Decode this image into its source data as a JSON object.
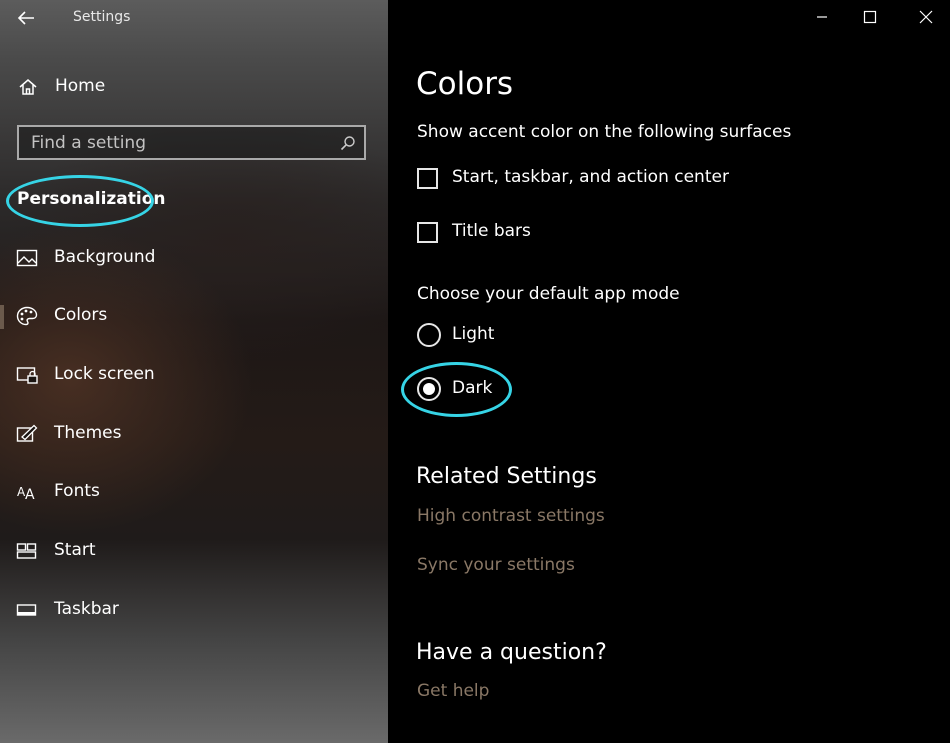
{
  "window": {
    "title": "Settings",
    "back_icon": "back-arrow-icon",
    "caption_buttons": [
      "minimize-icon",
      "maximize-icon",
      "close-icon"
    ]
  },
  "sidebar": {
    "home_label": "Home",
    "search": {
      "placeholder": "Find a setting"
    },
    "section_heading": "Personalization",
    "items": [
      {
        "label": "Background",
        "icon": "picture-icon"
      },
      {
        "label": "Colors",
        "icon": "palette-icon",
        "selected": true
      },
      {
        "label": "Lock screen",
        "icon": "lock-screen-icon"
      },
      {
        "label": "Themes",
        "icon": "themes-icon"
      },
      {
        "label": "Fonts",
        "icon": "fonts-icon"
      },
      {
        "label": "Start",
        "icon": "start-icon"
      },
      {
        "label": "Taskbar",
        "icon": "taskbar-icon"
      }
    ]
  },
  "main": {
    "title": "Colors",
    "accent_label": "Show accent color on the following surfaces",
    "checkboxes": [
      {
        "label": "Start, taskbar, and action center",
        "checked": false
      },
      {
        "label": "Title bars",
        "checked": false
      }
    ],
    "app_mode_label": "Choose your default app mode",
    "radios": [
      {
        "label": "Light",
        "selected": false
      },
      {
        "label": "Dark",
        "selected": true
      }
    ],
    "related_title": "Related Settings",
    "related_links": [
      "High contrast settings",
      "Sync your settings"
    ],
    "question_title": "Have a question?",
    "help_link": "Get help"
  },
  "colors": {
    "annotation": "#36d4e6",
    "link": "#8a7866",
    "background": "#000000"
  }
}
